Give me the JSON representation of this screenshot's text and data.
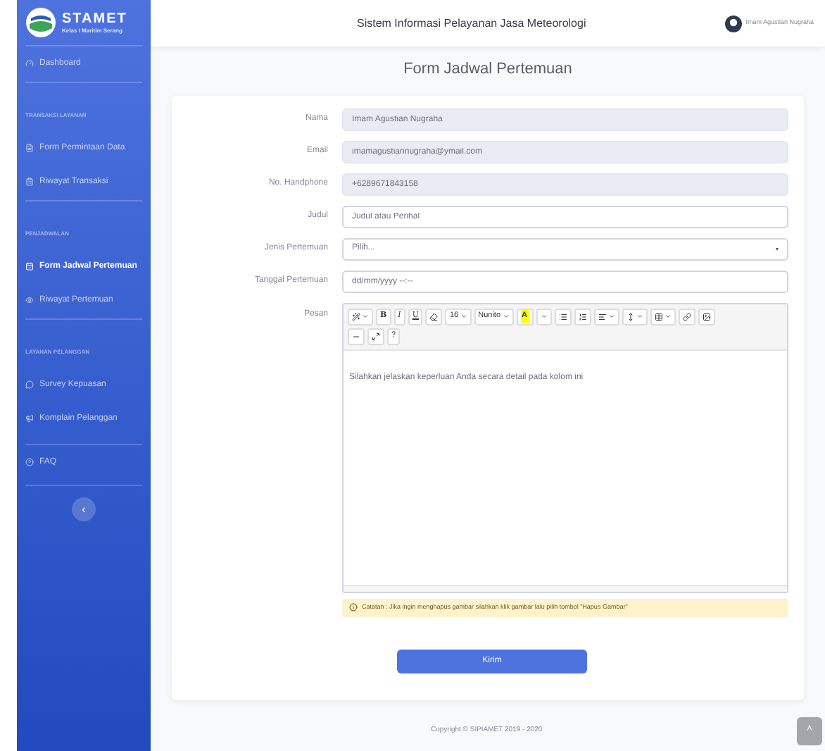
{
  "brand": {
    "name": "STAMET",
    "subtitle": "Kelas I Maritim Serang"
  },
  "sidebar": {
    "items": [
      {
        "kind": "item",
        "label": "Dashboard",
        "selected": false
      },
      {
        "kind": "header",
        "label": "TRANSAKSI LAYANAN"
      },
      {
        "kind": "item",
        "label": "Form Permintaan Data",
        "selected": false
      },
      {
        "kind": "item",
        "label": "Riwayat Transaksi",
        "selected": false
      },
      {
        "kind": "header",
        "label": "PENJADWALAN"
      },
      {
        "kind": "item",
        "label": "Form Jadwal Pertemuan",
        "selected": true
      },
      {
        "kind": "item",
        "label": "Riwayat Pertemuan",
        "selected": false
      },
      {
        "kind": "header",
        "label": "LAYANAN PELANGGAN"
      },
      {
        "kind": "item",
        "label": "Survey Kepuasan",
        "selected": false
      },
      {
        "kind": "item",
        "label": "Komplain Pelanggan",
        "selected": false
      },
      {
        "kind": "item",
        "label": "FAQ",
        "selected": false
      }
    ],
    "collapse_button": "‹"
  },
  "topbar": {
    "title": "Sistem Informasi Pelayanan Jasa Meteorologi",
    "user": "Imam Agustian Nugraha"
  },
  "page_title": "Form Jadwal Pertemuan",
  "form": {
    "fields": [
      {
        "label": "Nama",
        "kind": "readonly",
        "value": "Imam Agustian Nugraha"
      },
      {
        "label": "Email",
        "kind": "readonly",
        "value": "imamagustiannugraha@ymail.com"
      },
      {
        "label": "No. Handphone",
        "kind": "readonly",
        "value": "+6289671843158"
      },
      {
        "label": "Judul",
        "kind": "text",
        "placeholder": "Judul atau Perihal"
      },
      {
        "label": "Jenis Pertemuan",
        "kind": "select",
        "value": "Pilih..."
      },
      {
        "label": "Tanggal Pertemuan",
        "kind": "text",
        "placeholder": "dd/mm/yyyy --:--"
      }
    ],
    "message": {
      "label": "Pesan",
      "placeholder": "Silahkan jelaskan keperluan Anda secara detail pada kolom ini",
      "toolbar": [
        {
          "kind": "wand",
          "caret": true
        },
        {
          "kind": "bold",
          "label": "B"
        },
        {
          "kind": "italic",
          "label": "I"
        },
        {
          "kind": "underline",
          "label": "U"
        },
        {
          "kind": "eraser",
          "caret": false
        },
        {
          "kind": "text",
          "label": "16",
          "caret": true
        },
        {
          "kind": "text",
          "label": "Nunito",
          "caret": true
        },
        {
          "kind": "highlight",
          "label": "A"
        },
        {
          "kind": "caret"
        },
        {
          "kind": "ul",
          "caret": false
        },
        {
          "kind": "ol",
          "caret": false
        },
        {
          "kind": "align",
          "caret": true
        },
        {
          "kind": "height",
          "caret": true
        },
        {
          "kind": "table",
          "caret": true
        },
        {
          "kind": "link",
          "caret": false
        },
        {
          "kind": "image",
          "caret": false
        },
        {
          "kind": "hr",
          "caret": false
        },
        {
          "kind": "fullscreen",
          "caret": false
        },
        {
          "kind": "text",
          "label": "?",
          "caret": false
        }
      ]
    },
    "note": "Catatan : Jika ingin menghapus gambar silahkan klik gambar lalu pilih tombol \"Hapus Gambar\"",
    "submit": "Kirim"
  },
  "footer": "Copyright © SIPIAMET 2019 - 2020",
  "scroll_top_button": "˄"
}
